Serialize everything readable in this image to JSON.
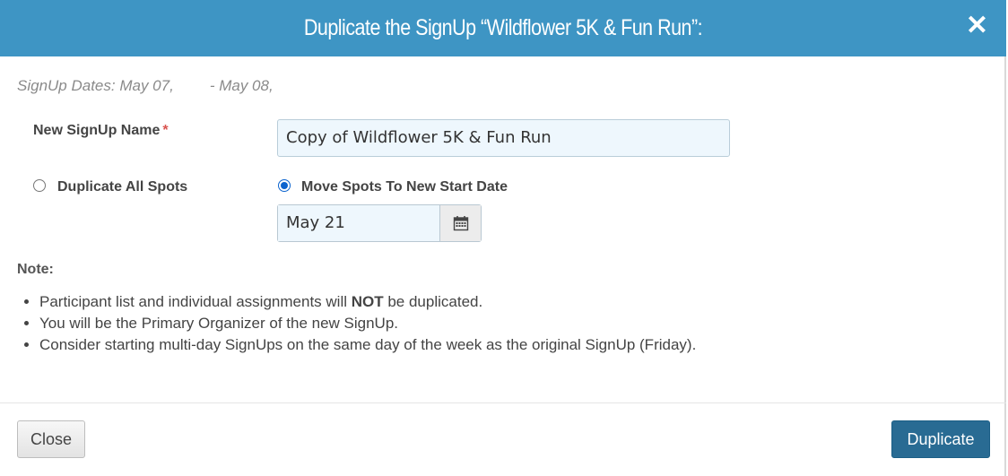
{
  "header": {
    "title": "Duplicate the SignUp “Wildflower 5K & Fun Run”:",
    "close_icon": "✕"
  },
  "dates": {
    "start": "SignUp Dates: May 07,",
    "end": "- May 08,"
  },
  "form": {
    "name_label": "New SignUp Name",
    "required_mark": "*",
    "name_value": "Copy of Wildflower 5K & Fun Run",
    "option_all": "Duplicate All Spots",
    "option_move": "Move Spots To New Start Date",
    "selected_option": "move",
    "start_date": "May 21"
  },
  "note": {
    "title": "Note:",
    "items": [
      {
        "pre": "Participant list and individual assignments will ",
        "bold": "NOT",
        "post": " be duplicated."
      },
      {
        "pre": "You will be the Primary Organizer of the new SignUp.",
        "bold": "",
        "post": ""
      },
      {
        "pre": "Consider starting multi-day SignUps on the same day of the week as the original SignUp (Friday).",
        "bold": "",
        "post": ""
      }
    ]
  },
  "footer": {
    "close_label": "Close",
    "duplicate_label": "Duplicate"
  },
  "colors": {
    "header": "#3e95c4",
    "primary_button": "#296b93",
    "input_bg": "#eef7fd"
  }
}
